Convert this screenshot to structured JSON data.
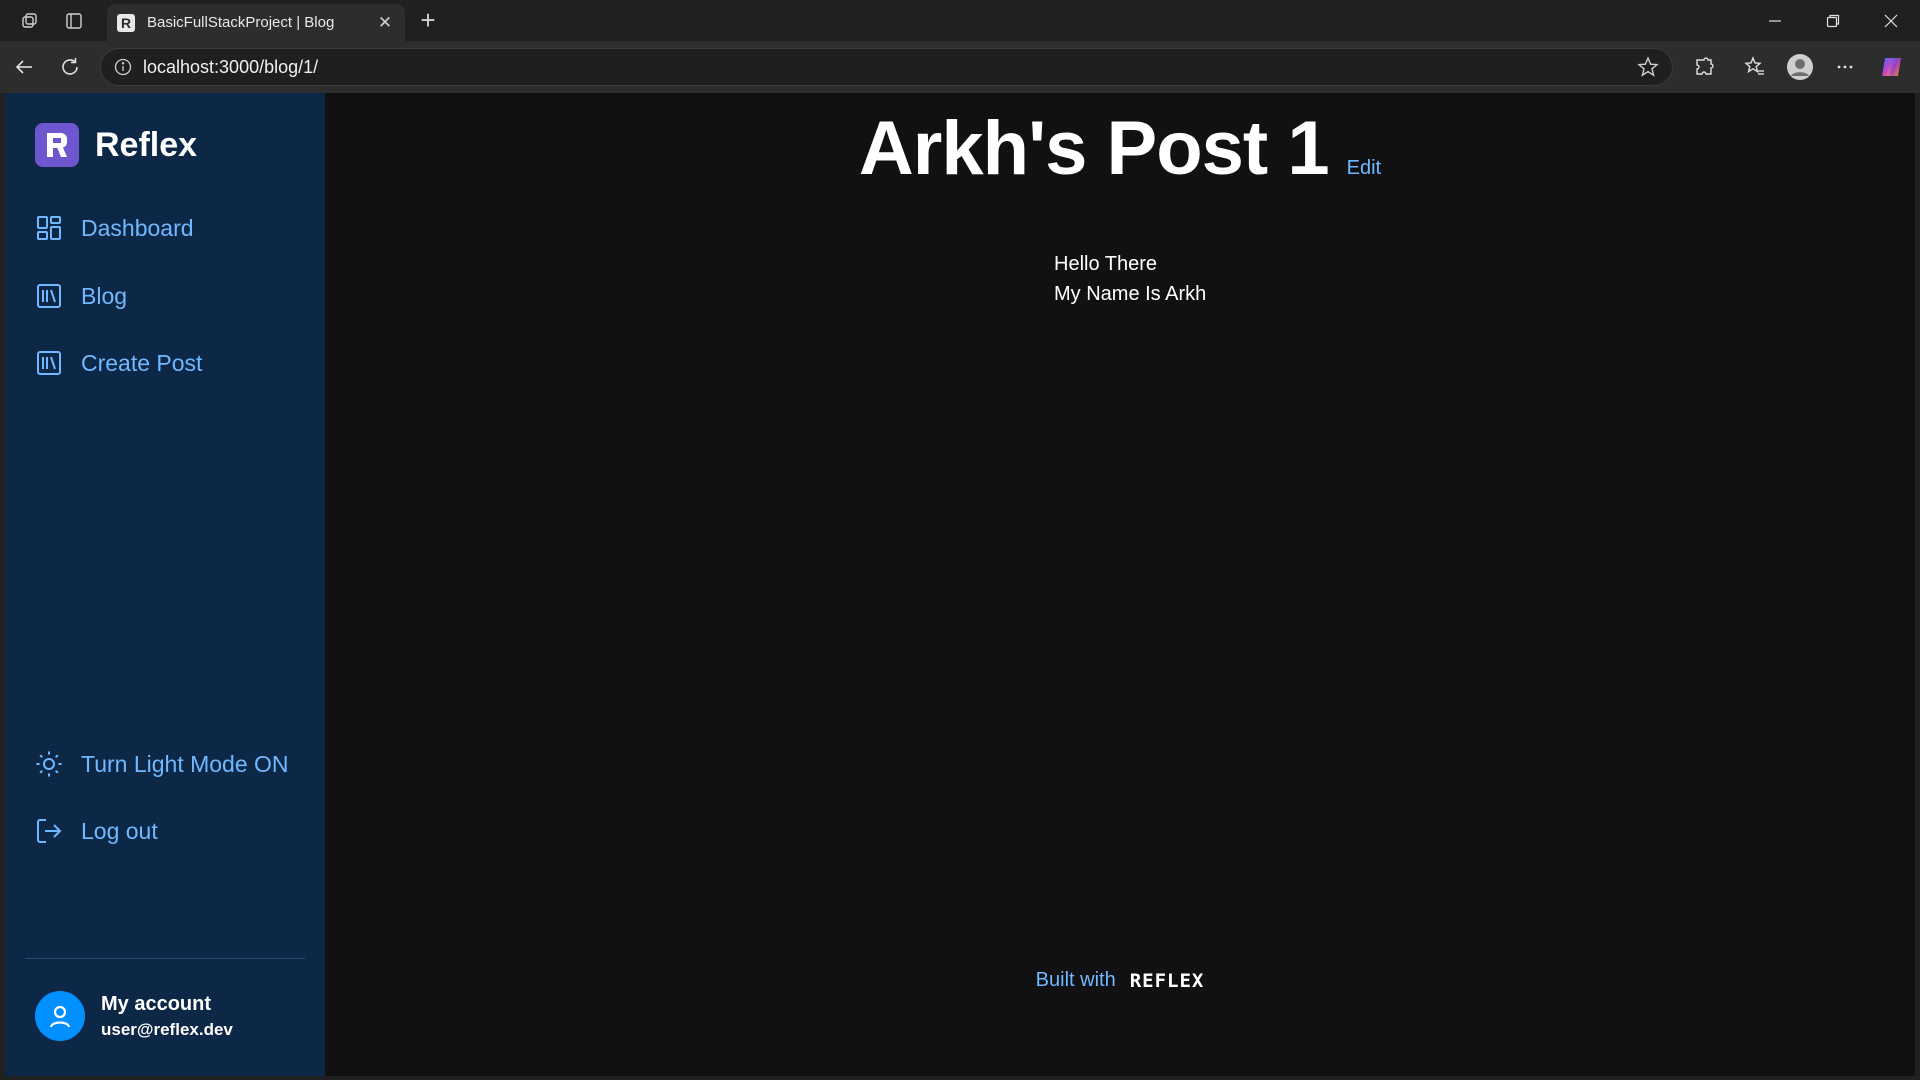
{
  "browser": {
    "tab_title": "BasicFullStackProject | Blog",
    "tab_favicon_letter": "R",
    "url": "localhost:3000/blog/1/",
    "icons": [
      "workspaces-icon",
      "tab-actions-icon",
      "close-icon",
      "new-tab-icon",
      "minimize-icon",
      "restore-icon",
      "window-close-icon",
      "back-icon",
      "refresh-icon",
      "info-icon",
      "favorite-star-icon",
      "extensions-icon",
      "favorites-icon",
      "profile-icon",
      "more-icon",
      "copilot-icon"
    ]
  },
  "sidebar": {
    "brand": "Reflex",
    "brand_color": "#6e56cf",
    "items": [
      {
        "label": "Dashboard",
        "icon": "layout-dashboard-icon"
      },
      {
        "label": "Blog",
        "icon": "library-icon"
      },
      {
        "label": "Create Post",
        "icon": "library-icon"
      }
    ],
    "bottom_items": [
      {
        "label": "Turn Light Mode ON",
        "icon": "sun-icon"
      },
      {
        "label": "Log out",
        "icon": "log-out-icon"
      }
    ],
    "account": {
      "name": "My account",
      "email": "user@reflex.dev"
    }
  },
  "post": {
    "title": "Arkh's Post 1",
    "edit_label": "Edit",
    "lines": [
      "Hello There",
      "My Name Is Arkh"
    ]
  },
  "footer": {
    "text": "Built with",
    "logo": "REFLEX"
  },
  "colors": {
    "sidebar_bg": "#0d2847",
    "accent": "#70b8ff",
    "main_bg": "#111113"
  }
}
